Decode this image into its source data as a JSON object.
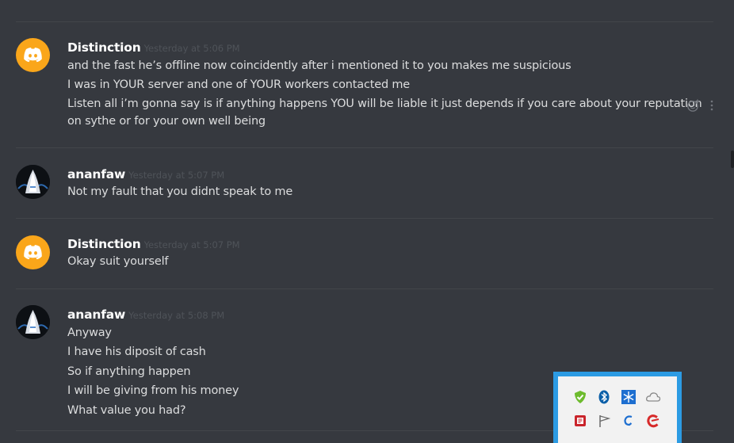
{
  "messages": [
    {
      "username": "Distinction",
      "timestamp": "Yesterday at 5:06 PM",
      "avatar": "discord-logo",
      "lines": [
        "and the fast he’s offline now coincidently after i mentioned it to you makes me suspicious",
        "I was in YOUR server and one of YOUR workers contacted me",
        "Listen all i’m gonna say is if anything happens YOU will be liable it just depends if you care about your reputation",
        "on sythe or for your own well being"
      ]
    },
    {
      "username": "ananfaw",
      "timestamp": "Yesterday at 5:07 PM",
      "avatar": "user-avatar",
      "lines": [
        "Not my fault that you didnt speak to me"
      ]
    },
    {
      "username": "Distinction",
      "timestamp": "Yesterday at 5:07 PM",
      "avatar": "discord-logo",
      "lines": [
        "Okay suit yourself"
      ]
    },
    {
      "username": "ananfaw",
      "timestamp": "Yesterday at 5:08 PM",
      "avatar": "user-avatar",
      "lines": [
        "Anyway",
        "I have his diposit of cash",
        "So if anything happen",
        "I will be giving from his money",
        "What value you had?"
      ]
    }
  ],
  "tray_icons": [
    "shield-check-icon",
    "bluetooth-icon",
    "snowflake-icon",
    "cloud-icon",
    "antivirus-icon",
    "flag-icon",
    "sync-icon",
    "ccleaner-icon"
  ],
  "colors": {
    "background": "#36393f",
    "username": "#ffffff",
    "text": "#dcddde",
    "timestamp": "#4f5359",
    "discord_avatar": "#faa61a",
    "tray_border": "#2c9be3"
  }
}
